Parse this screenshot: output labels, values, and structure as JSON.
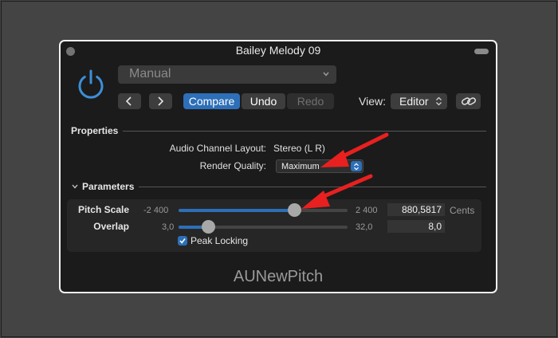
{
  "window": {
    "title": "Bailey Melody 09"
  },
  "header": {
    "preset_value": "Manual",
    "compare_label": "Compare",
    "undo_label": "Undo",
    "redo_label": "Redo",
    "view_label": "View:",
    "view_value": "Editor"
  },
  "properties": {
    "section_label": "Properties",
    "channel_layout_label": "Audio Channel Layout:",
    "channel_layout_value": "Stereo (L R)",
    "render_quality_label": "Render Quality:",
    "render_quality_value": "Maximum"
  },
  "parameters": {
    "section_label": "Parameters",
    "pitch": {
      "label": "Pitch Scale",
      "min_label": "-2 400",
      "max_label": "2 400",
      "min": -2400,
      "max": 2400,
      "value": 880.5817,
      "value_text": "880,5817",
      "unit": "Cents"
    },
    "overlap": {
      "label": "Overlap",
      "min_label": "3,0",
      "max_label": "32,0",
      "min": 3.0,
      "max": 32.0,
      "value": 8.0,
      "value_text": "8,0"
    },
    "peak_locking": {
      "label": "Peak Locking",
      "checked": true
    }
  },
  "footer": {
    "plugin_name": "AUNewPitch"
  },
  "colors": {
    "accent": "#2d6fb8",
    "power_icon": "#3d8fd8",
    "annotation_arrow": "#e82020",
    "window_bg": "#1b1b1b",
    "desktop_bg": "#444444"
  }
}
